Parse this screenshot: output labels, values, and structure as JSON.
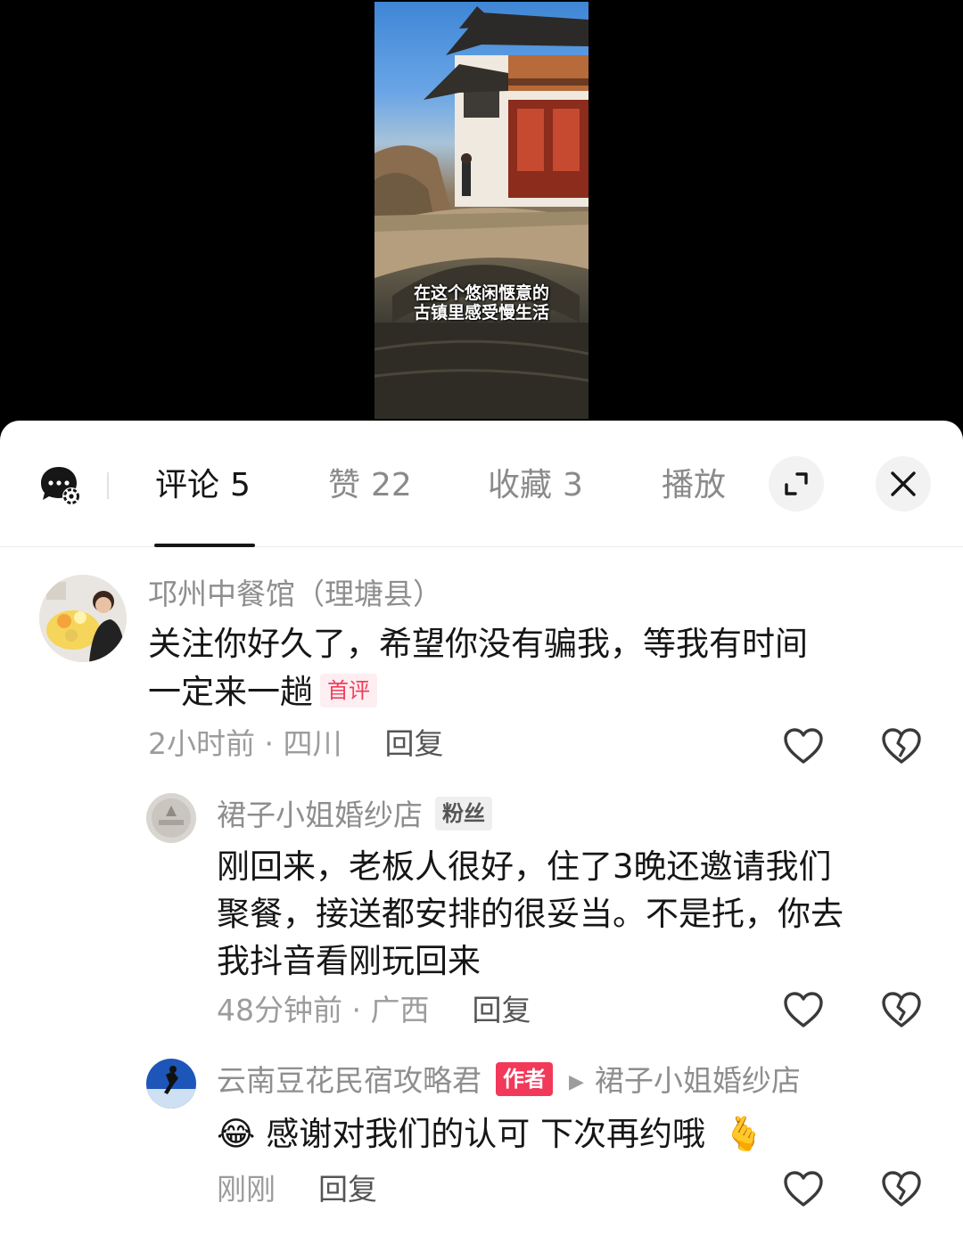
{
  "video": {
    "subtitle_line1": "在这个悠闲惬意的",
    "subtitle_line2": "古镇里感受慢生活"
  },
  "tabs": [
    {
      "label": "评论",
      "count": "5",
      "active": true
    },
    {
      "label": "赞",
      "count": "22",
      "active": false
    },
    {
      "label": "收藏",
      "count": "3",
      "active": false
    },
    {
      "label": "播放",
      "count": "",
      "active": false
    }
  ],
  "comments": [
    {
      "username": "邛州中餐馆（理塘县）",
      "text_line1": "关注你好久了，希望你没有骗我，等我有时间",
      "text_line2": "一定来一趟",
      "badge": "首评",
      "time_location": "2小时前 · 四川",
      "reply_label": "回复"
    },
    {
      "username": "裙子小姐婚纱店",
      "badge": "粉丝",
      "text_line1": "刚回来，老板人很好，住了3晚还邀请我们",
      "text_line2": "聚餐，接送都安排的很妥当。不是托，你去",
      "text_line3": "我抖音看刚玩回来",
      "time_location": "48分钟前 · 广西",
      "reply_label": "回复"
    },
    {
      "username": "云南豆花民宿攻略君",
      "badge": "作者",
      "reply_to": "裙子小姐婚纱店",
      "emoji_start": "😂",
      "text": "感谢对我们的认可 下次再约哦",
      "emoji_end": "🫰",
      "time_location": "刚刚",
      "reply_label": "回复"
    }
  ],
  "colors": {
    "badge_red": "#f2395a",
    "meta_gray": "#9c9c9c",
    "text_dark": "#161616"
  }
}
